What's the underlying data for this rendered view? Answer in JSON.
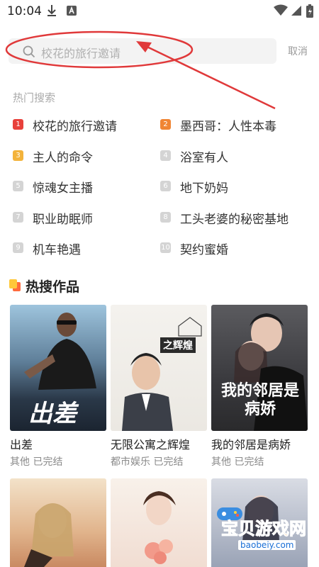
{
  "status_bar": {
    "time": "10:04",
    "icons": [
      "download-icon",
      "a-icon",
      "wifi-icon",
      "battery-icon"
    ]
  },
  "search": {
    "placeholder": "校花的旅行邀请",
    "cancel_label": "取消"
  },
  "hot_search": {
    "label": "热门搜索",
    "items": [
      {
        "rank": "1",
        "text": "校花的旅行邀请",
        "color": "#e8413b"
      },
      {
        "rank": "2",
        "text": "墨西哥：人性本毒",
        "color": "#f08534"
      },
      {
        "rank": "3",
        "text": "主人的命令",
        "color": "#f3b33b"
      },
      {
        "rank": "4",
        "text": "浴室有人",
        "color": "#d4d4d4"
      },
      {
        "rank": "5",
        "text": "惊魂女主播",
        "color": "#d4d4d4"
      },
      {
        "rank": "6",
        "text": "地下奶妈",
        "color": "#d4d4d4"
      },
      {
        "rank": "7",
        "text": "职业助眠师",
        "color": "#d4d4d4"
      },
      {
        "rank": "8",
        "text": "工头老婆的秘密基地",
        "color": "#d4d4d4"
      },
      {
        "rank": "9",
        "text": "机车艳遇",
        "color": "#d4d4d4"
      },
      {
        "rank": "10",
        "text": "契约蜜婚",
        "color": "#d4d4d4"
      }
    ]
  },
  "hot_works": {
    "title": "热搜作品",
    "books": [
      {
        "title": "出差",
        "meta": "其他 已完结",
        "cover_text": "出差"
      },
      {
        "title": "无限公寓之辉煌",
        "meta": "都市娱乐 已完结",
        "cover_text": "之辉煌"
      },
      {
        "title": "我的邻居是病娇",
        "meta": "其他 已完结",
        "cover_text": "我的邻居是病娇"
      }
    ]
  },
  "watermark": {
    "text": "宝贝游戏网",
    "url": "baobeiy.com"
  }
}
